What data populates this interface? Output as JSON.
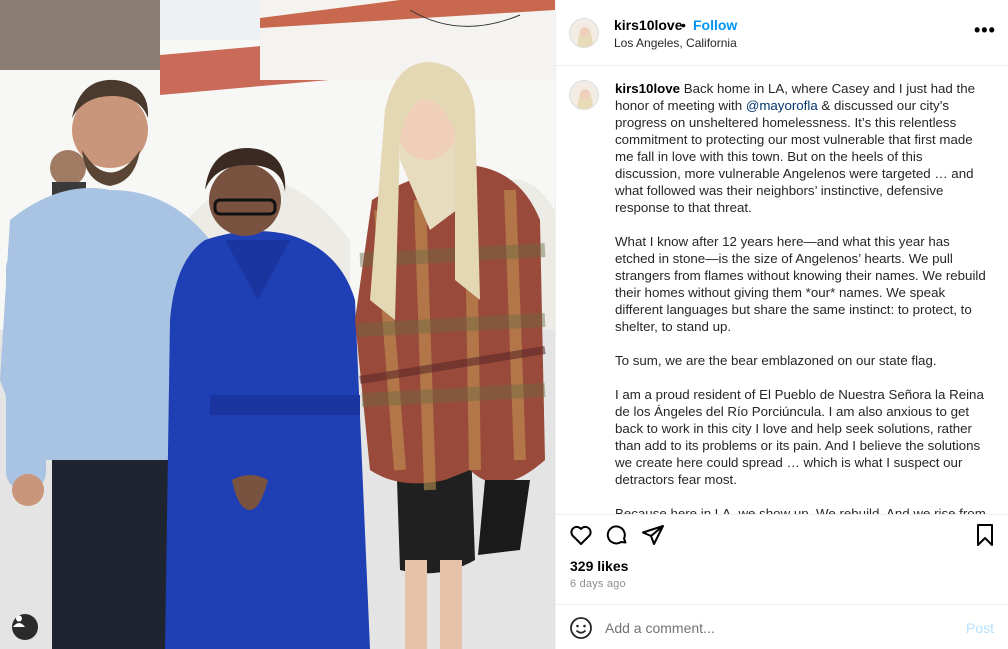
{
  "post": {
    "username": "kirs10love",
    "follow_label": "Follow",
    "separator": "•",
    "location": "Los Angeles, California",
    "more_label": "•••"
  },
  "caption": {
    "username": "kirs10love",
    "p1_before": "Back home in LA, where Casey and I just had the honor of meeting with ",
    "mention": "@mayorofla",
    "p1_after": " & discussed our city’s progress on unsheltered homelessness. It’s this relentless commitment to protecting our most vulnerable that first made me fall in love with this town. But on the heels of this discussion, more vulnerable Angelenos were targeted … and what followed was their neighbors’ instinctive, defensive response to that threat.",
    "p2": "What I know after 12 years here—and what this year has etched in stone—is the size of Angelenos’ hearts. We pull strangers from flames without knowing their names. We rebuild their homes without giving them *our* names. We speak different languages but share the same instinct: to protect, to shelter, to stand up.",
    "p3": "To sum, we are the bear emblazoned on our state flag.",
    "p4": "I am a proud resident of El Pueblo de Nuestra Señora la Reina de los Ángeles del Río Porciúncula. I am also anxious to get back to work in this city I love and help seek solutions, rather than add to its problems or its pain. And I believe the solutions we create here could spread … which is what I suspect our detractors fear most.",
    "p5": "Because here in LA, we show up. We rebuild. And we rise from"
  },
  "stats": {
    "likes": "329 likes",
    "time": "6 days ago"
  },
  "comment": {
    "placeholder": "Add a comment...",
    "post_label": "Post"
  },
  "icons": {
    "like": "heart-icon",
    "comment": "comment-icon",
    "share": "share-icon",
    "save": "bookmark-icon",
    "emoji": "emoji-icon",
    "tag": "user-tag-icon",
    "more": "more-icon"
  },
  "colors": {
    "link": "#0095f6",
    "mention": "#00376b",
    "muted": "#8e8e8e",
    "post_disabled": "#b2dffc",
    "coat_blue": "#1f3fb5"
  }
}
